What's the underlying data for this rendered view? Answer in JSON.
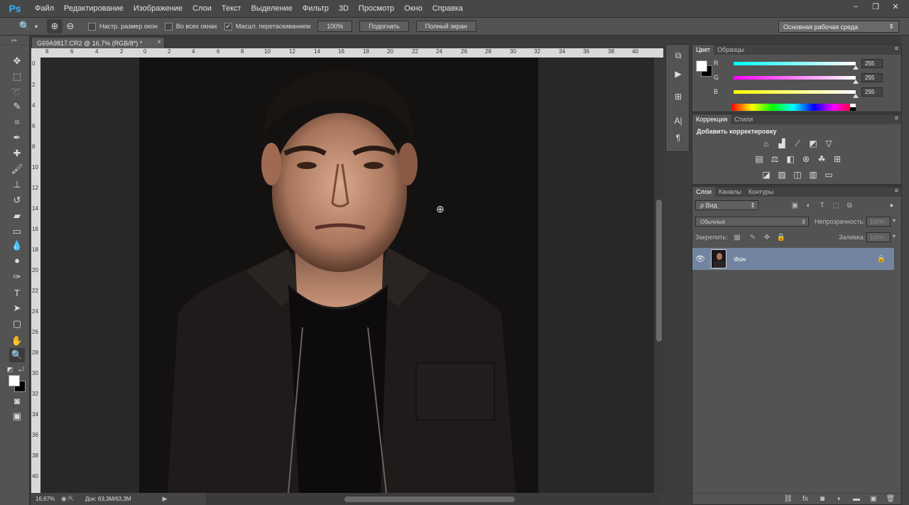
{
  "app": {
    "logo": "Ps"
  },
  "menu": [
    "Файл",
    "Редактирование",
    "Изображение",
    "Слои",
    "Текст",
    "Выделение",
    "Фильтр",
    "3D",
    "Просмотр",
    "Окно",
    "Справка"
  ],
  "window_controls": {
    "minimize": "–",
    "restore": "❐",
    "close": "✕"
  },
  "options": {
    "resize_windows": "Настр. размер окон",
    "all_windows": "Во всех окнах",
    "scrubby_zoom": "Масшт. перетаскиванием",
    "btn_100": "100%",
    "btn_fit": "Подогнать",
    "btn_fullscreen": "Полный экран",
    "workspace": "Основная рабочая среда",
    "checkbox_states": {
      "resize_windows": false,
      "all_windows": false,
      "scrubby_zoom": true
    }
  },
  "document": {
    "tab_title": "G69A9817.CR2 @ 16,7% (RGB/8*) *",
    "ruler_top": [
      "8",
      "6",
      "4",
      "2",
      "0",
      "2",
      "4",
      "6",
      "8",
      "10",
      "12",
      "14",
      "16",
      "18",
      "20",
      "22",
      "24",
      "26",
      "28",
      "30",
      "32",
      "34",
      "36",
      "38",
      "40"
    ],
    "ruler_left": [
      "0",
      "2",
      "4",
      "6",
      "8",
      "10",
      "12",
      "14",
      "16",
      "18",
      "20",
      "22",
      "24",
      "26",
      "28",
      "30",
      "32",
      "34",
      "36",
      "38",
      "40"
    ],
    "zoom": "16,67%",
    "doc_size": "Док: 63,3M/63,3M"
  },
  "color_panel": {
    "tabs": [
      "Цвет",
      "Образцы"
    ],
    "channels": [
      {
        "label": "R",
        "value": "255",
        "color": "#00d8e0"
      },
      {
        "label": "G",
        "value": "255",
        "color": "#e030d8"
      },
      {
        "label": "B",
        "value": "255",
        "color": "#e8e000"
      }
    ]
  },
  "adjustments_panel": {
    "tabs": [
      "Коррекция",
      "Стили"
    ],
    "title": "Добавить корректировку"
  },
  "layers_panel": {
    "tabs": [
      "Слои",
      "Каналы",
      "Контуры"
    ],
    "kind_filter": "ρ Вид",
    "blend_mode": "Обычные",
    "opacity_label": "Непрозрачность:",
    "opacity_value": "100%",
    "lock_label": "Закрепить:",
    "fill_label": "Заливка:",
    "fill_value": "100%",
    "layers": [
      {
        "name": "Фон",
        "visible": true,
        "locked": true
      }
    ]
  }
}
